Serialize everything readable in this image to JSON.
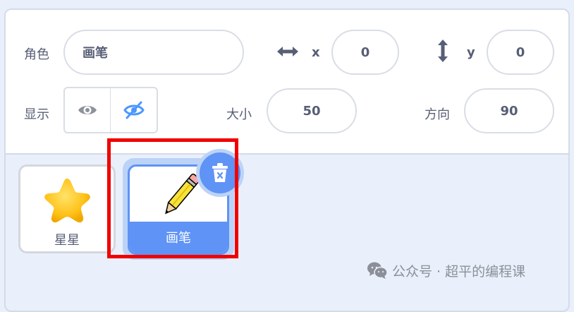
{
  "sprite_info": {
    "sprite_label": "角色",
    "sprite_name": "画笔",
    "x_label": "x",
    "x_value": "0",
    "y_label": "y",
    "y_value": "0",
    "show_label": "显示",
    "size_label": "大小",
    "size_value": "50",
    "direction_label": "方向",
    "direction_value": "90"
  },
  "sprites": [
    {
      "name": "星星",
      "icon": "star-icon",
      "selected": false
    },
    {
      "name": "画笔",
      "icon": "pencil-icon",
      "selected": true
    }
  ],
  "watermark": {
    "text": "公众号 · 超平的编程课"
  },
  "colors": {
    "accent": "#5f93f5",
    "highlight": "#f00000",
    "text": "#575e75"
  }
}
